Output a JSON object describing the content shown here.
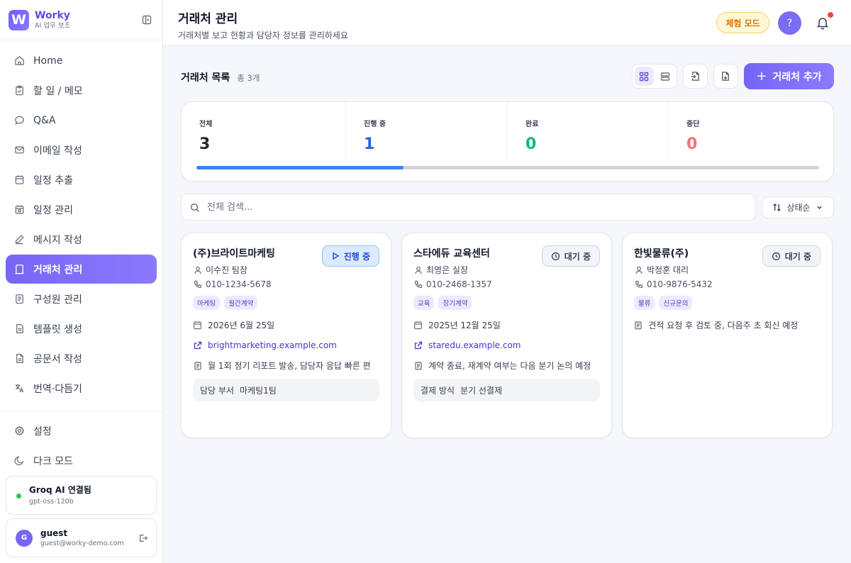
{
  "app": {
    "name": "Worky",
    "subtitle": "AI 업무 보조"
  },
  "nav": {
    "items": [
      {
        "label": "Home",
        "icon": "home-icon"
      },
      {
        "label": "할 일 / 메모",
        "icon": "clipboard-icon"
      },
      {
        "label": "Q&A",
        "icon": "chat-bubble-icon"
      },
      {
        "label": "이메일 작성",
        "icon": "mail-icon"
      },
      {
        "label": "일정 추출",
        "icon": "calendar-icon"
      },
      {
        "label": "일정 관리",
        "icon": "calendar-check-icon"
      },
      {
        "label": "메시지 작성",
        "icon": "pencil-icon"
      },
      {
        "label": "거래처 관리",
        "icon": "building-icon",
        "active": true
      },
      {
        "label": "구성원 관리",
        "icon": "id-card-icon"
      },
      {
        "label": "템플릿 생성",
        "icon": "document-icon"
      },
      {
        "label": "공문서 작성",
        "icon": "file-text-icon"
      },
      {
        "label": "번역·다듬기",
        "icon": "translate-icon"
      }
    ],
    "bottom": [
      {
        "label": "설정",
        "icon": "gear-icon"
      },
      {
        "label": "다크 모드",
        "icon": "moon-icon"
      }
    ]
  },
  "ai_status": {
    "title": "Groq AI 연결됨",
    "model": "gpt-oss-120b"
  },
  "user": {
    "initial": "G",
    "name": "guest",
    "email": "guest@worky-demo.com"
  },
  "header": {
    "title": "거래처 관리",
    "subtitle": "거래처별 보고 현황과 담당자 정보를 관리하세요",
    "trial_label": "체험 모드",
    "help_label": "?"
  },
  "list": {
    "title": "거래처 목록",
    "count": "총 3개",
    "add_label": "거래처 추가"
  },
  "stats": [
    {
      "label": "전체",
      "value": "3",
      "color": "#1f2937"
    },
    {
      "label": "진행 중",
      "value": "1",
      "color": "#2563eb"
    },
    {
      "label": "완료",
      "value": "0",
      "color": "#10b981"
    },
    {
      "label": "중단",
      "value": "0",
      "color": "#f87171"
    }
  ],
  "progress_fraction": 0.333,
  "search": {
    "placeholder": "전체 검색..."
  },
  "sort": {
    "label": "상태순"
  },
  "cards": [
    {
      "name": "(주)브라이트마케팅",
      "status": "진행 중",
      "status_type": "progress",
      "contact": "이수진 팀장",
      "phone": "010-1234-5678",
      "tags": [
        "마케팅",
        "월간계약"
      ],
      "date": "2026년 6월 25일",
      "website": "brightmarketing.example.com",
      "memo": "월 1회 정기 리포트 발송, 담당자 응답 빠른 편",
      "extra_label": "담당 부서",
      "extra_value": "마케팅1팀"
    },
    {
      "name": "스타에듀 교육센터",
      "status": "대기 중",
      "status_type": "wait",
      "contact": "최영은 실장",
      "phone": "010-2468-1357",
      "tags": [
        "교육",
        "장기계약"
      ],
      "date": "2025년 12월 25일",
      "website": "staredu.example.com",
      "memo": "계약 종료, 재계약 여부는 다음 분기 논의 예정",
      "extra_label": "결제 방식",
      "extra_value": "분기 선결제"
    },
    {
      "name": "한빛물류(주)",
      "status": "대기 중",
      "status_type": "wait",
      "contact": "박정훈 대리",
      "phone": "010-9876-5432",
      "tags": [
        "물류",
        "신규문의"
      ],
      "memo": "견적 요청 후 검토 중, 다음주 초 회신 예정"
    }
  ]
}
